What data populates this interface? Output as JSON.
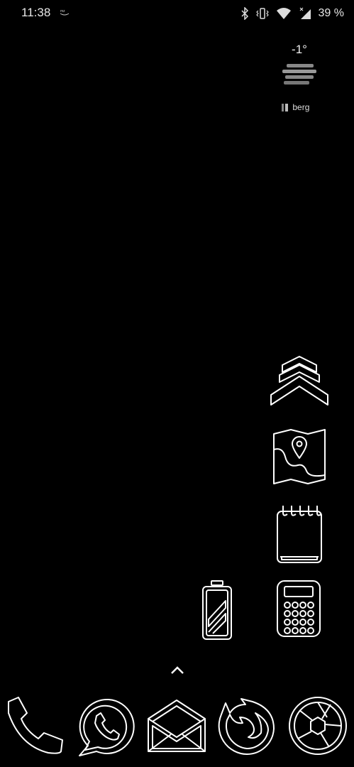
{
  "status_bar": {
    "time": "11:38",
    "battery_percent": "39 %",
    "icons": [
      "amazon-notification-icon",
      "bluetooth-icon",
      "vibrate-icon",
      "wifi-icon",
      "cell-signal-icon"
    ]
  },
  "weather_widget": {
    "temperature": "-1°",
    "city": "berg",
    "icon": "fog-icon"
  },
  "home_icons": [
    {
      "name": "chevrons-app-icon"
    },
    {
      "name": "maps-app-icon"
    },
    {
      "name": "notepad-app-icon"
    },
    {
      "name": "battery-app-icon"
    },
    {
      "name": "calculator-app-icon"
    }
  ],
  "dock": [
    {
      "name": "phone-icon"
    },
    {
      "name": "whatsapp-icon"
    },
    {
      "name": "email-icon"
    },
    {
      "name": "firefox-icon"
    },
    {
      "name": "camera-shutter-icon"
    }
  ],
  "colors": {
    "background": "#000000",
    "icon_stroke": "#ffffff",
    "status_text": "#e8e8e8"
  }
}
